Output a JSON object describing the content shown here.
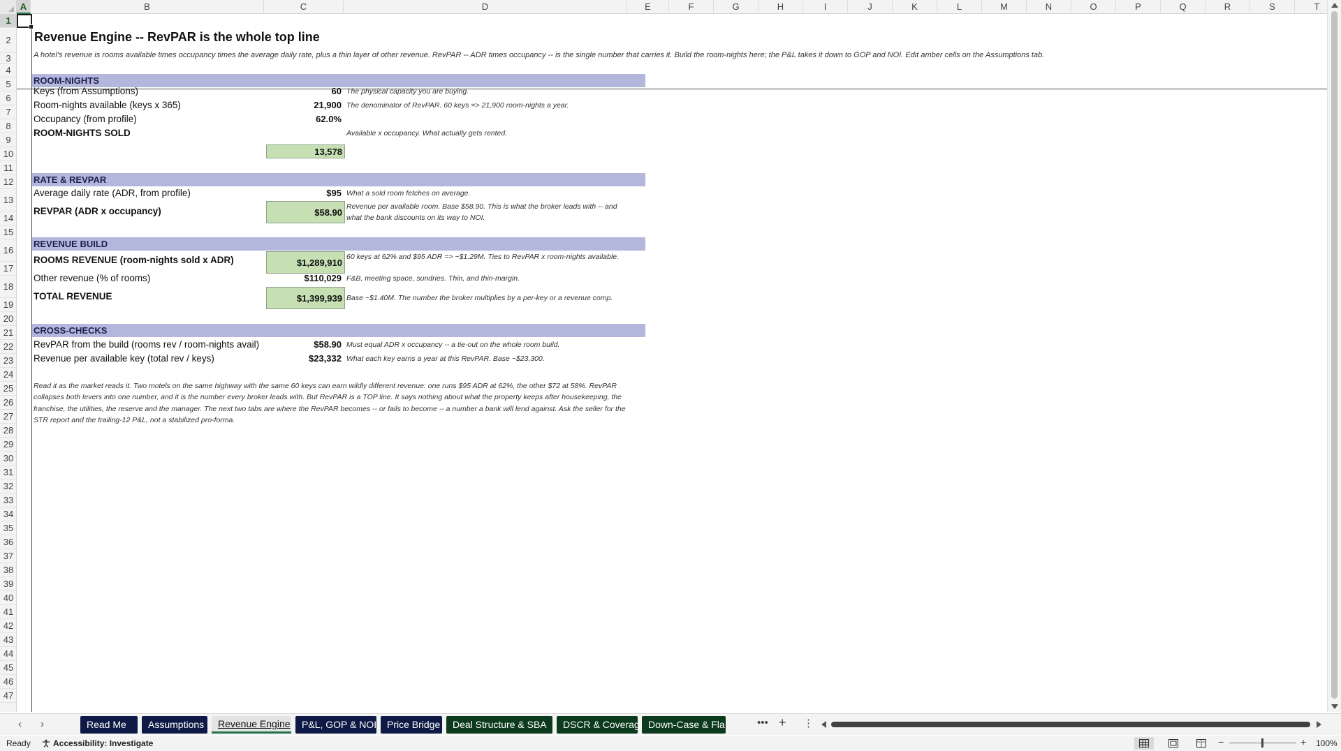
{
  "columns": [
    "A",
    "B",
    "C",
    "D",
    "E",
    "F",
    "G",
    "H",
    "I",
    "J",
    "K",
    "L",
    "M",
    "N",
    "O",
    "P",
    "Q",
    "R",
    "S",
    "T"
  ],
  "selected_column": "A",
  "rows": [
    "1",
    "2",
    "3",
    "4",
    "5",
    "6",
    "7",
    "8",
    "9",
    "10",
    "11",
    "12",
    "13",
    "14",
    "15",
    "16",
    "17",
    "18",
    "19",
    "20",
    "21",
    "22",
    "23",
    "24",
    "25",
    "26",
    "27",
    "28",
    "29",
    "30",
    "31",
    "32",
    "33",
    "34",
    "35",
    "36",
    "37",
    "38",
    "39",
    "40",
    "41",
    "42",
    "43",
    "44",
    "45",
    "46",
    "47"
  ],
  "selected_row": "1",
  "sheet": {
    "title": "Revenue Engine -- RevPAR is the whole top line",
    "subtitle": "A hotel's revenue is rooms available times occupancy times the average daily rate, plus a thin layer of other revenue. RevPAR -- ADR times occupancy -- is the single number that carries it. Build the room-nights here; the P&L takes it down to GOP and NOI. Edit amber cells on the Assumptions tab.",
    "sections": {
      "room_nights": "ROOM-NIGHTS",
      "rate_revpar": "RATE & REVPAR",
      "revenue_build": "REVENUE BUILD",
      "cross_checks": "CROSS-CHECKS"
    },
    "lines": {
      "keys": {
        "label": "Keys (from Assumptions)",
        "value": "60",
        "note": "The physical capacity you are buying."
      },
      "room_nights_available": {
        "label": "Room-nights available (keys x 365)",
        "value": "21,900",
        "note": "The denominator of RevPAR. 60 keys => 21,900 room-nights a year."
      },
      "occupancy": {
        "label": "Occupancy (from profile)",
        "value": "62.0%"
      },
      "room_nights_sold": {
        "label": "ROOM-NIGHTS SOLD",
        "value": "13,578",
        "note": "Available x occupancy. What actually gets rented."
      },
      "adr": {
        "label": "Average daily rate (ADR, from profile)",
        "value": "$95",
        "note": "What a sold room fetches on average."
      },
      "revpar": {
        "label": "REVPAR (ADR x occupancy)",
        "value": "$58.90",
        "note": "Revenue per available room. Base $58.90. This is what the broker leads with -- and what the bank discounts on its way to NOI."
      },
      "rooms_revenue": {
        "label": "ROOMS REVENUE (room-nights sold x ADR)",
        "value": "$1,289,910",
        "note": "60 keys at 62% and $95 ADR => ~$1.29M. Ties to RevPAR x room-nights available."
      },
      "other_revenue": {
        "label": "Other revenue (% of rooms)",
        "value": "$110,029",
        "note": "F&B, meeting space, sundries. Thin, and thin-margin."
      },
      "total_revenue": {
        "label": "TOTAL REVENUE",
        "value": "$1,399,939",
        "note": "Base ~$1.40M. The number the broker multiplies by a per-key or a revenue comp."
      },
      "revpar_check": {
        "label": "RevPAR from the build (rooms rev / room-nights avail)",
        "value": "$58.90",
        "note": "Must equal ADR x occupancy -- a tie-out on the whole room build."
      },
      "rev_per_key": {
        "label": "Revenue per available key (total rev / keys)",
        "value": "$23,332",
        "note": "What each key earns a year at this RevPAR. Base ~$23,300."
      }
    },
    "paragraph": "Read it as the market reads it. Two motels on the same highway with the same 60 keys can earn wildly different revenue: one runs $95 ADR at 62%, the other $72 at 58%. RevPAR collapses both levers into one number, and it is the number every broker leads with. But RevPAR is a TOP line. It says nothing about what the property keeps after housekeeping, the franchise, the utilities, the reserve and the manager. The next two tabs are where the RevPAR becomes -- or fails to become -- a number a bank will lend against. Ask the seller for the STR report and the trailing-12 P&L, not a stabilized pro-forma."
  },
  "tabs": [
    {
      "label": "Read Me",
      "color": "#0e1a45"
    },
    {
      "label": "Assumptions",
      "color": "#0e1a45"
    },
    {
      "label": "Revenue Engine",
      "color": "#0e1a45",
      "active": true
    },
    {
      "label": "P&L, GOP & NOI",
      "color": "#0e1a45"
    },
    {
      "label": "Price Bridge",
      "color": "#0e1a45"
    },
    {
      "label": "Deal Structure & SBA",
      "color": "#0b3a1c"
    },
    {
      "label": "DSCR & Coverage",
      "color": "#0b3a1c"
    },
    {
      "label": "Down-Case & Fla",
      "color": "#0b3a1c"
    }
  ],
  "tabbar": {
    "more": "•••",
    "add": "+",
    "options": "⋮"
  },
  "status": {
    "ready": "Ready",
    "accessibility": "Accessibility: Investigate",
    "zoom": "100%"
  },
  "icons": {
    "prev_sheet": "chevron-left-icon",
    "next_sheet": "chevron-right-icon",
    "normal_view": "grid-icon",
    "page_layout": "page-layout-icon",
    "page_break": "page-break-icon"
  }
}
